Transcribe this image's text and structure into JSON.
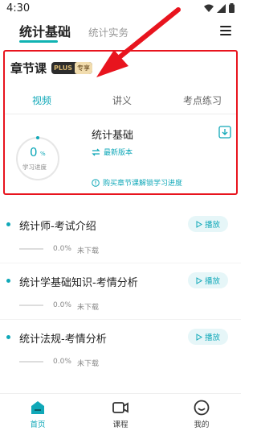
{
  "status_bar": {
    "time": "4:30",
    "icons": [
      "wifi-icon",
      "signal-icon",
      "battery-icon"
    ]
  },
  "top_tabs": {
    "main": "统计基础",
    "secondary": "统计实务",
    "menu_icon": "menu-icon"
  },
  "chapter": {
    "title": "章节课",
    "badge_plus": "PLUS",
    "badge_exclusive": "专享",
    "tabs": [
      {
        "label": "视频",
        "active": true
      },
      {
        "label": "讲义",
        "active": false
      },
      {
        "label": "考点练习",
        "active": false
      }
    ],
    "progress": {
      "value": "0",
      "unit": "%",
      "label": "学习进度",
      "fraction": 0
    },
    "course_title": "统计基础",
    "version": "最新版本",
    "notice": "购买章节课解锁学习进度"
  },
  "lessons": [
    {
      "title": "统计师-考试介绍",
      "play": "播放",
      "percent": "0.0%",
      "status": "未下载"
    },
    {
      "title": "统计学基础知识-考情分析",
      "play": "播放",
      "percent": "0.0%",
      "status": "未下载"
    },
    {
      "title": "统计法规-考情分析",
      "play": "播放",
      "percent": "0.0%",
      "status": "未下载"
    }
  ],
  "bottom_nav": {
    "items": [
      {
        "label": "首页",
        "icon": "home-icon",
        "active": true
      },
      {
        "label": "课程",
        "icon": "video-icon",
        "active": false
      },
      {
        "label": "我的",
        "icon": "smile-icon",
        "active": false
      }
    ]
  },
  "colors": {
    "accent": "#10a8b8",
    "highlight_border": "#e8141e"
  }
}
